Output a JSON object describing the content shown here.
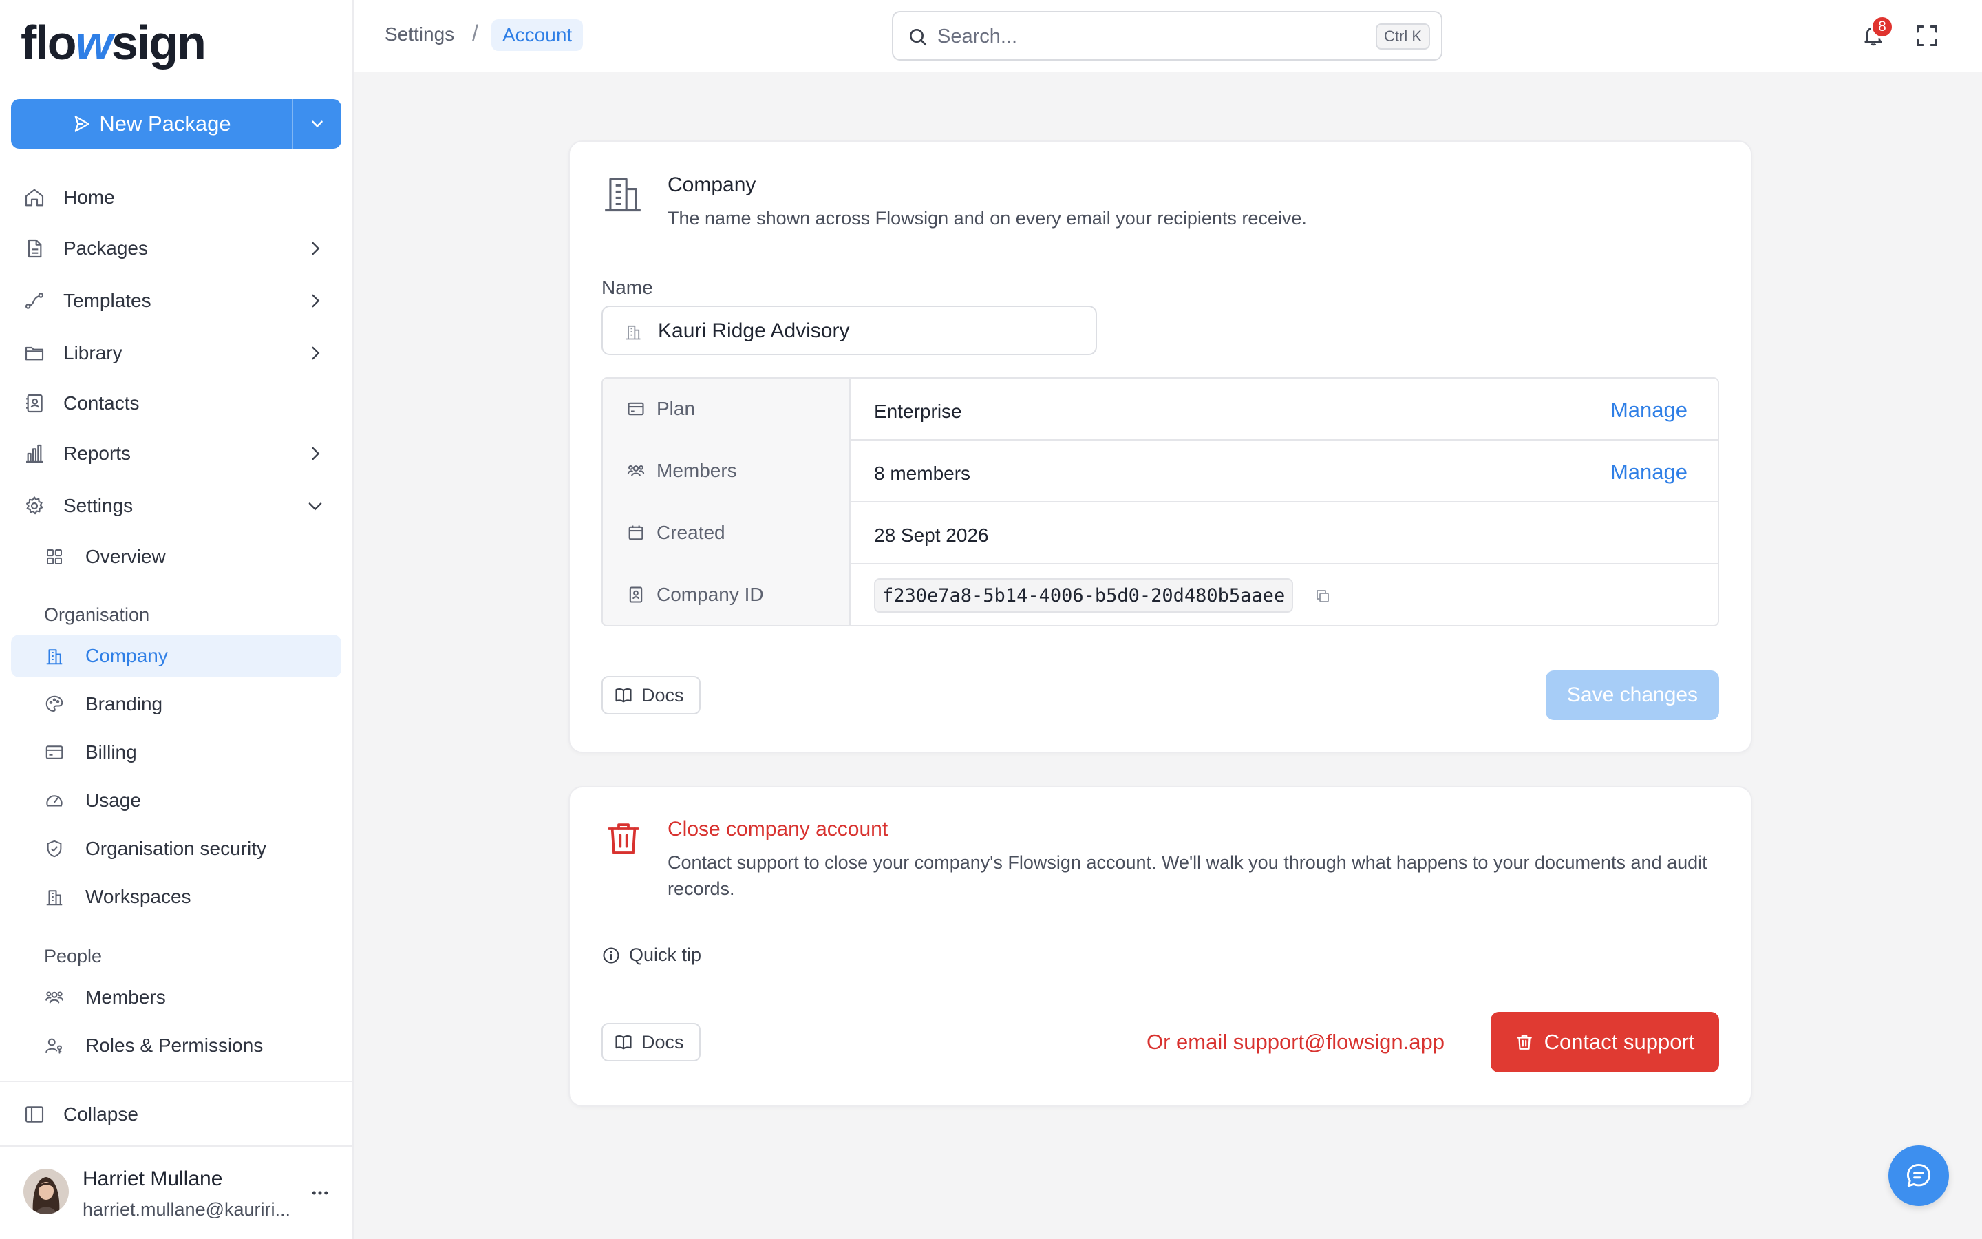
{
  "app": {
    "logo_parts": [
      "flo",
      "w",
      "sign"
    ],
    "brand_color": "#3d8fef",
    "danger_color": "#e03a32"
  },
  "sidebar": {
    "new_package_label": "New Package",
    "nav": [
      {
        "label": "Home",
        "icon": "home-icon",
        "has_chevron": false
      },
      {
        "label": "Packages",
        "icon": "document-icon",
        "has_chevron": true
      },
      {
        "label": "Templates",
        "icon": "route-icon",
        "has_chevron": true
      },
      {
        "label": "Library",
        "icon": "folder-icon",
        "has_chevron": true
      },
      {
        "label": "Contacts",
        "icon": "contact-book-icon",
        "has_chevron": false
      },
      {
        "label": "Reports",
        "icon": "bar-chart-icon",
        "has_chevron": true
      },
      {
        "label": "Settings",
        "icon": "gear-icon",
        "expanded": true
      }
    ],
    "settings_overview": "Overview",
    "section_organisation": "Organisation",
    "organisation_items": [
      {
        "label": "Company",
        "icon": "building-icon",
        "active": true
      },
      {
        "label": "Branding",
        "icon": "palette-icon"
      },
      {
        "label": "Billing",
        "icon": "credit-card-icon"
      },
      {
        "label": "Usage",
        "icon": "gauge-icon"
      },
      {
        "label": "Organisation security",
        "icon": "shield-icon"
      },
      {
        "label": "Workspaces",
        "icon": "buildings-icon"
      }
    ],
    "section_people": "People",
    "people_items": [
      {
        "label": "Members",
        "icon": "users-icon"
      },
      {
        "label": "Roles & Permissions",
        "icon": "user-key-icon"
      }
    ],
    "collapse_label": "Collapse",
    "user": {
      "name": "Harriet Mullane",
      "email": "harriet.mullane@kauriri..."
    }
  },
  "topbar": {
    "breadcrumb": [
      "Settings",
      "Account"
    ],
    "search_placeholder": "Search...",
    "search_shortcut": "Ctrl K",
    "notification_count": "8"
  },
  "company_card": {
    "title": "Company",
    "description": "The name shown across Flowsign and on every email your recipients receive.",
    "name_label": "Name",
    "name_value": "Kauri Ridge Advisory",
    "rows": [
      {
        "key": "Plan",
        "value": "Enterprise",
        "action": "Manage",
        "icon": "credit-card-icon"
      },
      {
        "key": "Members",
        "value": "8 members",
        "action": "Manage",
        "icon": "users-icon"
      },
      {
        "key": "Created",
        "value": "28 Sept 2026",
        "icon": "calendar-icon"
      },
      {
        "key": "Company ID",
        "value": "f230e7a8-5b14-4006-b5d0-20d480b5aaee",
        "icon": "id-badge-icon"
      }
    ],
    "docs_label": "Docs",
    "save_label": "Save changes"
  },
  "danger_card": {
    "title": "Close company account",
    "description": "Contact support to close your company's Flowsign account. We'll walk you through what happens to your documents and audit records.",
    "quick_tip_label": "Quick tip",
    "docs_label": "Docs",
    "email_link": "Or email support@flowsign.app",
    "contact_label": "Contact support"
  }
}
